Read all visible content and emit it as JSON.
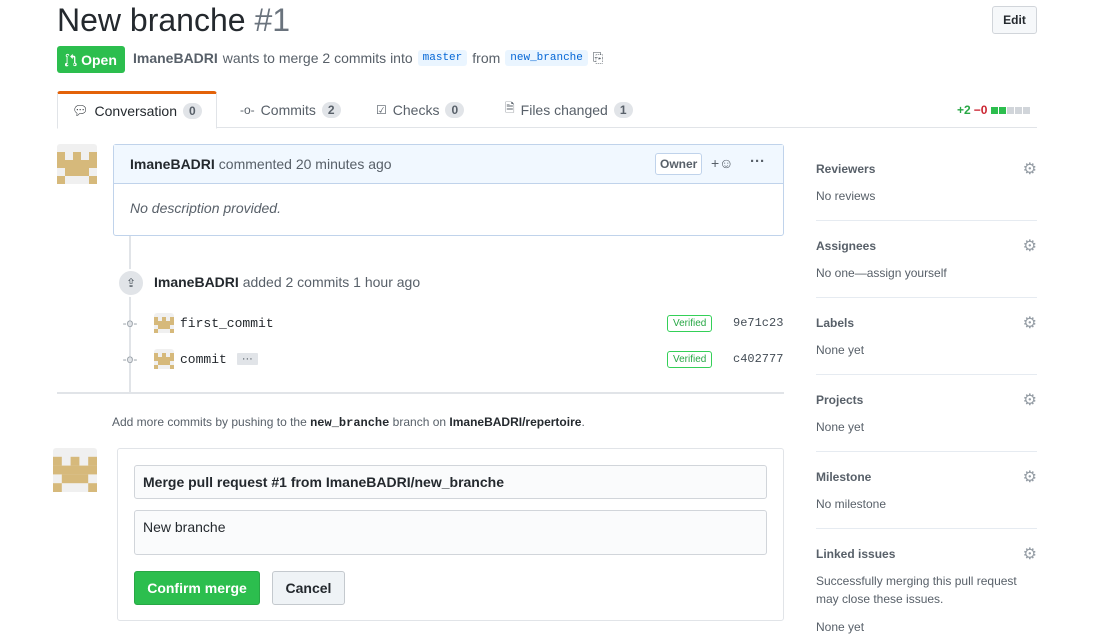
{
  "header": {
    "title": "New branche",
    "number": "#1",
    "edit_label": "Edit",
    "state_label": "Open",
    "author": "ImaneBADRI",
    "merge_text": "wants to merge 2 commits into",
    "base_branch": "master",
    "from_text": "from",
    "head_branch": "new_branche"
  },
  "tabs": [
    {
      "label": "Conversation",
      "count": "0"
    },
    {
      "label": "Commits",
      "count": "2"
    },
    {
      "label": "Checks",
      "count": "0"
    },
    {
      "label": "Files changed",
      "count": "1"
    }
  ],
  "diffstat": {
    "additions": "+2",
    "deletions": "−0",
    "color_add": "#2cbe4e",
    "color_neutral": "#d1d5da"
  },
  "comment": {
    "author": "ImaneBADRI",
    "meta": "commented 20 minutes ago",
    "owner_badge": "Owner",
    "body": "No description provided."
  },
  "event": {
    "author": "ImaneBADRI",
    "text": "added 2 commits 1 hour ago"
  },
  "commits": [
    {
      "message": "first_commit",
      "verified": "Verified",
      "sha": "9e71c23"
    },
    {
      "message": "commit",
      "verified": "Verified",
      "sha": "c402777"
    }
  ],
  "push_note": {
    "prefix": "Add more commits by pushing to the",
    "branch": "new_branche",
    "middle": "branch on",
    "repo": "ImaneBADRI/repertoire",
    "suffix": "."
  },
  "merge": {
    "title": "Merge pull request #1 from ImaneBADRI/new_branche",
    "description": "New branche",
    "confirm_label": "Confirm merge",
    "cancel_label": "Cancel"
  },
  "sidebar": [
    {
      "heading": "Reviewers",
      "value": "No reviews"
    },
    {
      "heading": "Assignees",
      "value": "No one—assign yourself"
    },
    {
      "heading": "Labels",
      "value": "None yet"
    },
    {
      "heading": "Projects",
      "value": "None yet"
    },
    {
      "heading": "Milestone",
      "value": "No milestone"
    },
    {
      "heading": "Linked issues",
      "value": "Successfully merging this pull request may close these issues.",
      "value2": "None yet"
    }
  ],
  "colors": {
    "accent_green": "#2cbe4e",
    "link_blue": "#0366d6",
    "tab_active": "#e36209"
  }
}
